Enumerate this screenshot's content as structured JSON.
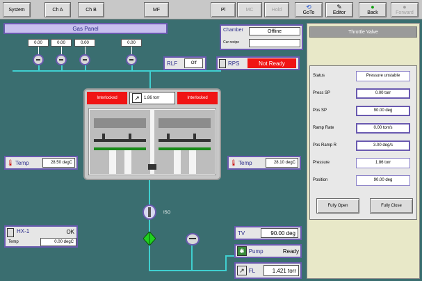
{
  "toolbar": {
    "system": "System",
    "ch_a": "Ch A",
    "ch_b": "Ch B",
    "mf": "MF",
    "btn_a": "Pl",
    "btn_b": "MC",
    "btn_c": "Hold",
    "goto": "GoTo",
    "editor": "Editor",
    "back": "Back",
    "forward": "Forward"
  },
  "gas_panel": {
    "title": "Gas Panel",
    "mfc_values": [
      "0.00",
      "0.00",
      "0.00",
      "0.00"
    ]
  },
  "rlf": {
    "label": "RLF",
    "value": "Off"
  },
  "chamber_status": {
    "label": "Chamber",
    "value": "Offline",
    "recipe_label": "Cur recipe",
    "recipe_value": ""
  },
  "rps": {
    "label": "RPS",
    "value": "Not Ready"
  },
  "chamber": {
    "interlocked_left": "Interlocked",
    "interlocked_right": "Interlocked",
    "pressure": "1.86 torr"
  },
  "temp_left": {
    "label": "Temp",
    "value": "28.50 degC"
  },
  "temp_right": {
    "label": "Temp",
    "value": "28.10 degC"
  },
  "hx": {
    "label": "HX-1",
    "status": "OK",
    "temp_label": "Temp",
    "temp_value": "0.00 degC"
  },
  "valve_label": "ISO",
  "tv": {
    "label": "TV",
    "value": "90.00 deg"
  },
  "pump": {
    "label": "Pump",
    "value": "Ready"
  },
  "foreline": {
    "label": "FL",
    "value": "1.421 torr"
  },
  "throttle_valve": {
    "title": "Throttle Valve",
    "rows": [
      {
        "label": "Status",
        "value": "Pressure unstable"
      },
      {
        "label": "Press SP",
        "value": "0.00 torr"
      },
      {
        "label": "Pos SP",
        "value": "90.00 deg"
      },
      {
        "label": "Ramp Rate",
        "value": "0.00 torr/s"
      },
      {
        "label": "Pos Ramp R",
        "value": "3.00 deg/s"
      },
      {
        "label": "Pressure",
        "value": "1.86 torr"
      },
      {
        "label": "Position",
        "value": "90.00 deg"
      }
    ],
    "fully_open": "Fully Open",
    "fully_close": "Fully Close"
  },
  "colors": {
    "background": "#3a6e70",
    "pipe": "#3fd0d0",
    "accent": "#6a5ab0",
    "alarm": "#f01414"
  }
}
